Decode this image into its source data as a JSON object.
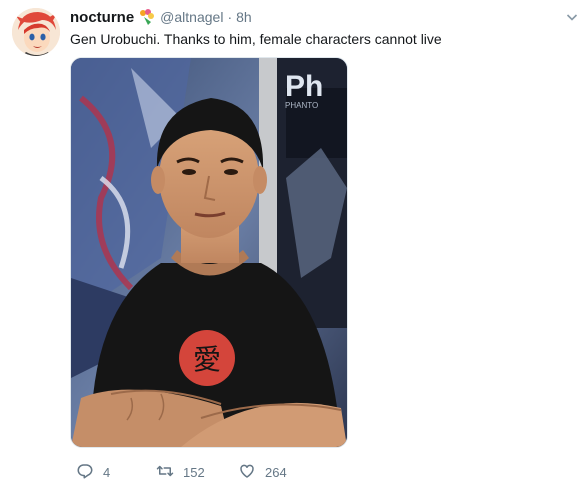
{
  "tweet": {
    "display_name": "nocturne",
    "handle": "@altnagel",
    "separator": "·",
    "time": "8h",
    "text": "Gen Urobuchi. Thanks to him, female characters cannot live",
    "photo_kanji": "愛",
    "poster_text": "Ph",
    "poster_subtext": "PHANTO"
  },
  "actions": {
    "reply_count": "4",
    "retweet_count": "152",
    "like_count": "264"
  },
  "icons": {
    "avatar": "avatar-icon",
    "flower": "bouquet-icon",
    "menu": "chevron-down-icon",
    "reply": "reply-icon",
    "retweet": "retweet-icon",
    "like": "heart-icon"
  },
  "colors": {
    "text_primary": "#14171a",
    "text_secondary": "#657786",
    "border": "#e1e8ed"
  }
}
